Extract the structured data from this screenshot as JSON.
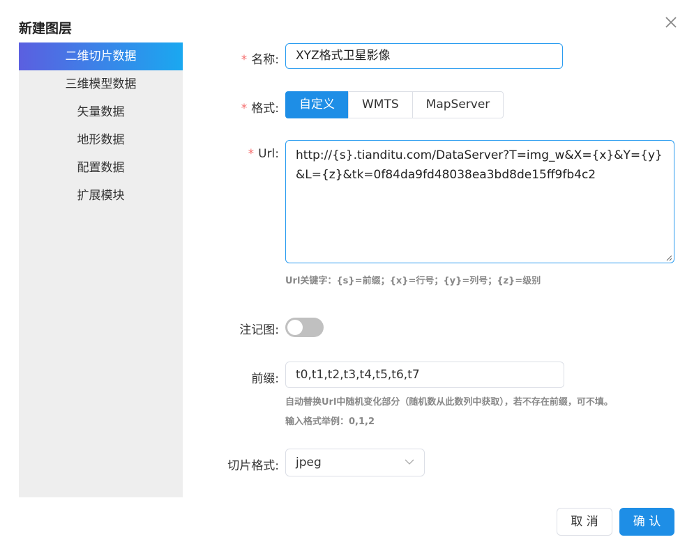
{
  "dialog": {
    "title": "新建图层"
  },
  "sidebar": {
    "items": [
      {
        "label": "二维切片数据",
        "active": true
      },
      {
        "label": "三维模型数据"
      },
      {
        "label": "矢量数据"
      },
      {
        "label": "地形数据"
      },
      {
        "label": "配置数据"
      },
      {
        "label": "扩展模块"
      }
    ]
  },
  "form": {
    "name": {
      "label": "名称:",
      "value": "XYZ格式卫星影像"
    },
    "format": {
      "label": "格式:",
      "options": [
        "自定义",
        "WMTS",
        "MapServer"
      ],
      "selected": "自定义"
    },
    "url": {
      "label": "Url:",
      "value": "http://{s}.tianditu.com/DataServer?T=img_w&X={x}&Y={y}&L={z}&tk=0f84da9fd48038ea3bd8de15ff9fb4c2",
      "hint": "Url关键字：{s}=前缀；{x}=行号；{y}=列号；{z}=级别"
    },
    "annotation": {
      "label": "注记图:",
      "enabled": false
    },
    "prefix": {
      "label": "前缀:",
      "value": "t0,t1,t2,t3,t4,t5,t6,t7",
      "hint1": "自动替换Url中随机变化部分（随机数从此数列中获取），若不存在前缀，可不填。",
      "hint2": "输入格式举例：0,1,2"
    },
    "tile_format": {
      "label": "切片格式:",
      "value": "jpeg"
    }
  },
  "buttons": {
    "cancel": "取 消",
    "ok": "确 认"
  },
  "colors": {
    "primary": "#1e8ee6",
    "required": "#f56c6c",
    "sidebar_bg": "#eeeeee"
  }
}
